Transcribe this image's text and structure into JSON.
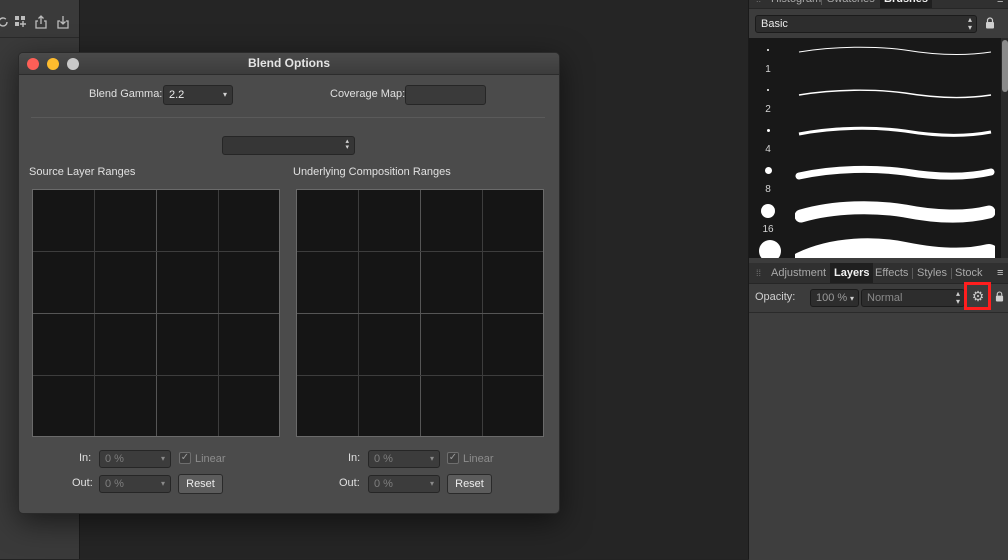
{
  "toolbar_icons": [
    "rotate-icon",
    "grid-add-icon",
    "share-icon",
    "export-icon"
  ],
  "brushes_panel": {
    "tabs": [
      {
        "label": "Histogram",
        "active": false
      },
      {
        "label": "Swatches",
        "active": false
      },
      {
        "label": "Brushes",
        "active": true
      }
    ],
    "category": "Basic",
    "brushes": [
      {
        "size": "1"
      },
      {
        "size": "2"
      },
      {
        "size": "4"
      },
      {
        "size": "8"
      },
      {
        "size": "16"
      }
    ]
  },
  "layers_panel": {
    "tabs": [
      {
        "label": "Adjustment",
        "active": false
      },
      {
        "label": "Layers",
        "active": true
      },
      {
        "label": "Effects",
        "active": false
      },
      {
        "label": "Styles",
        "active": false
      },
      {
        "label": "Stock",
        "active": false
      }
    ],
    "opacity_label": "Opacity:",
    "opacity_value": "100 %",
    "blend_mode": "Normal",
    "highlight_color": "#ff1e1e"
  },
  "dialog": {
    "title": "Blend Options",
    "blend_gamma_label": "Blend Gamma:",
    "blend_gamma_value": "2.2",
    "coverage_map_label": "Coverage Map:",
    "channel_select_value": "",
    "source": {
      "title": "Source Layer Ranges",
      "in_label": "In:",
      "in_value": "0 %",
      "out_label": "Out:",
      "out_value": "0 %",
      "linear_label": "Linear",
      "linear_checked": true,
      "reset_label": "Reset"
    },
    "underlying": {
      "title": "Underlying Composition Ranges",
      "in_label": "In:",
      "in_value": "0 %",
      "out_label": "Out:",
      "out_value": "0 %",
      "linear_label": "Linear",
      "linear_checked": true,
      "reset_label": "Reset"
    }
  },
  "colors": {
    "close": "#fd5f57",
    "minimize": "#febc2e",
    "zoom": "#c9c9c9"
  }
}
